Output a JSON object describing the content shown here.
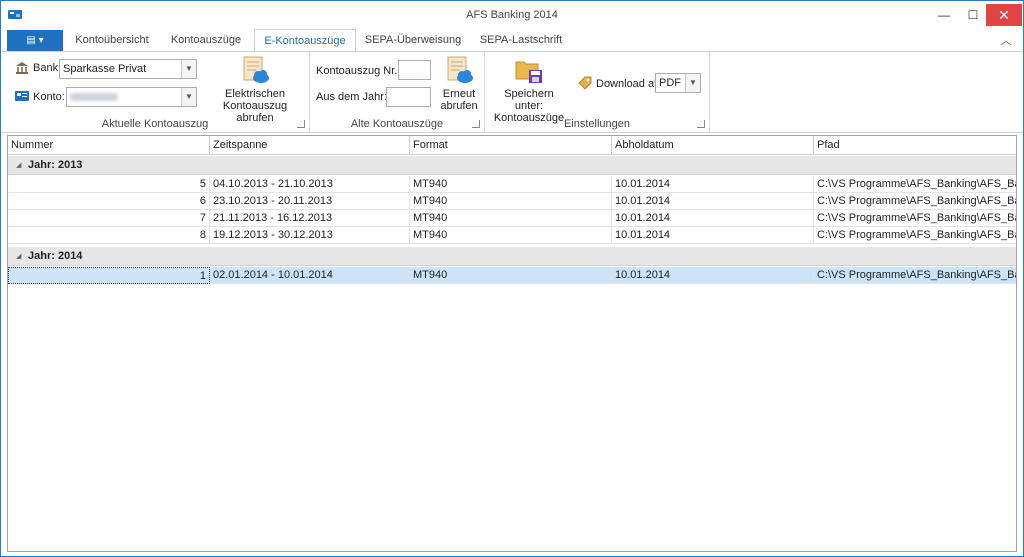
{
  "window": {
    "title": "AFS Banking 2014"
  },
  "titlebar": {
    "min_glyph": "—",
    "max_glyph": "☐",
    "close_glyph": "✕"
  },
  "tabs": {
    "file_glyph": "▤ ▾",
    "items": [
      "Kontoübersicht",
      "Kontoauszüge",
      "E-Kontoauszüge",
      "SEPA-Überweisung",
      "SEPA-Lastschrift"
    ],
    "active_index": 2,
    "collapse_glyph": "︿"
  },
  "ribbon": {
    "group1": {
      "bank_label": "Bank:",
      "bank_value": "Sparkasse Privat",
      "konto_label": "Konto:",
      "fetch_button": [
        "Elektrischen",
        "Kontoauszug abrufen"
      ],
      "label": "Aktuelle Kontoauszug"
    },
    "group2": {
      "nr_label": "Kontoauszug Nr.:",
      "year_label": "Aus dem Jahr:",
      "refetch_button": [
        "Erneut",
        "abrufen"
      ],
      "label": "Alte Kontoauszüge"
    },
    "group3": {
      "save_button": [
        "Speichern unter:",
        "Kontoauszüge"
      ],
      "download_label": "Download als",
      "download_value": "PDF",
      "label": "Einstellungen"
    }
  },
  "grid": {
    "columns": [
      "Nummer",
      "Zeitspanne",
      "Format",
      "Abholdatum",
      "Pfad"
    ],
    "groups": [
      {
        "label": "Jahr: 2013",
        "rows": [
          [
            "5",
            "04.10.2013 - 21.10.2013",
            "MT940",
            "10.01.2014",
            "C:\\VS Programme\\AFS_Banking\\AFS_Ban..."
          ],
          [
            "6",
            "23.10.2013 - 20.11.2013",
            "MT940",
            "10.01.2014",
            "C:\\VS Programme\\AFS_Banking\\AFS_Ban..."
          ],
          [
            "7",
            "21.11.2013 - 16.12.2013",
            "MT940",
            "10.01.2014",
            "C:\\VS Programme\\AFS_Banking\\AFS_Ban..."
          ],
          [
            "8",
            "19.12.2013 - 30.12.2013",
            "MT940",
            "10.01.2014",
            "C:\\VS Programme\\AFS_Banking\\AFS_Ban..."
          ]
        ]
      },
      {
        "label": "Jahr: 2014",
        "rows": [
          [
            "1",
            "02.01.2014 - 10.01.2014",
            "MT940",
            "10.01.2014",
            "C:\\VS Programme\\AFS_Banking\\AFS_Ban..."
          ]
        ]
      }
    ],
    "selected_row": "1"
  },
  "colors": {
    "accent": "#1f70c1",
    "selection": "#cce4f7",
    "close": "#e04343",
    "group_bg": "#e6e6e6"
  }
}
